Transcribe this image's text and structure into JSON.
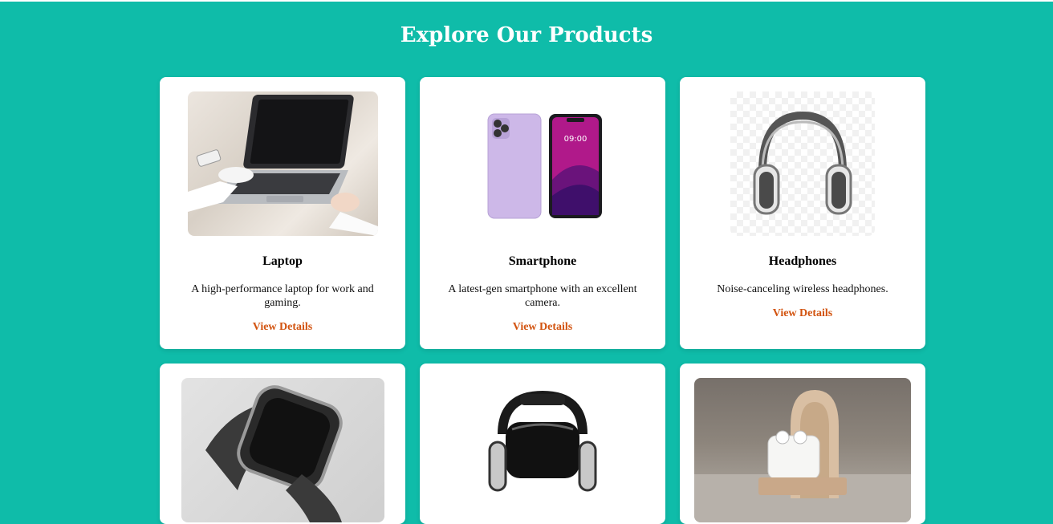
{
  "page": {
    "title": "Explore Our Products"
  },
  "products": [
    {
      "name": "Laptop",
      "description": "A high-performance laptop for work and gaming.",
      "link": "View Details",
      "image": "laptop-photo"
    },
    {
      "name": "Smartphone",
      "description": "A latest-gen smartphone with an excellent camera.",
      "link": "View Details",
      "image": "smartphone-photo"
    },
    {
      "name": "Headphones",
      "description": "Noise-canceling wireless headphones.",
      "link": "View Details",
      "image": "headphones-photo"
    },
    {
      "image": "smartwatch-photo"
    },
    {
      "image": "vr-headset-photo"
    },
    {
      "image": "earbuds-photo"
    }
  ],
  "phone_screen_time": "09:00",
  "colors": {
    "background": "#0fbca9",
    "card": "#ffffff",
    "link": "#d2530f",
    "title": "#ffffff"
  }
}
